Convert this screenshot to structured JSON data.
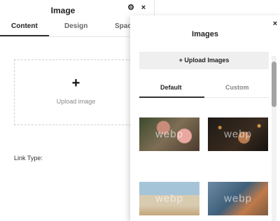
{
  "panel": {
    "title": "Image",
    "tabs": [
      "Content",
      "Design",
      "Spaci"
    ],
    "upload_plus": "+",
    "upload_label": "Upload image",
    "link_type_label": "Link Type:",
    "link_type_caret": "▼"
  },
  "modal": {
    "title": "Images",
    "close": "×",
    "upload_button": "+ Upload Images",
    "tabs": [
      "Default",
      "Custom"
    ],
    "thumbnails": [
      {
        "watermark": "webp",
        "subject": "pink roses"
      },
      {
        "watermark": "webp",
        "subject": "dark bokeh"
      },
      {
        "watermark": "webp",
        "subject": "beach grass"
      },
      {
        "watermark": "webp",
        "subject": "blue fabric"
      }
    ]
  },
  "icons": {
    "settings": "⚙",
    "close": "×"
  }
}
